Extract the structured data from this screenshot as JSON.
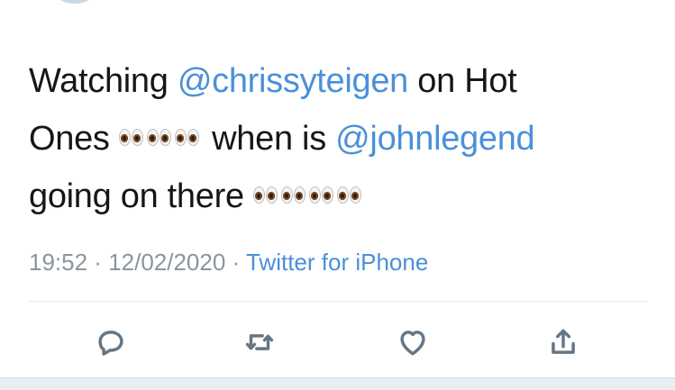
{
  "tweet": {
    "line1_text": "Watching ",
    "line1_mention": "@chrissyteigen",
    "line1_suffix": " on Hot",
    "line2_text": "Ones ",
    "line2_middle": " when is ",
    "line2_mention": "@johnlegend",
    "line3_text": "going on there ",
    "emoji_name": "eyes-emoji"
  },
  "meta": {
    "time": "19:52",
    "separator1": " · ",
    "date": "12/02/2020",
    "separator2": " · ",
    "source": "Twitter for iPhone"
  },
  "actions": {
    "reply_icon": "reply-icon",
    "retweet_icon": "retweet-icon",
    "like_icon": "heart-icon",
    "share_icon": "share-icon"
  },
  "colors": {
    "link": "#4a90d9",
    "text": "#14171a",
    "muted": "#8a959e",
    "icon": "#657786"
  }
}
